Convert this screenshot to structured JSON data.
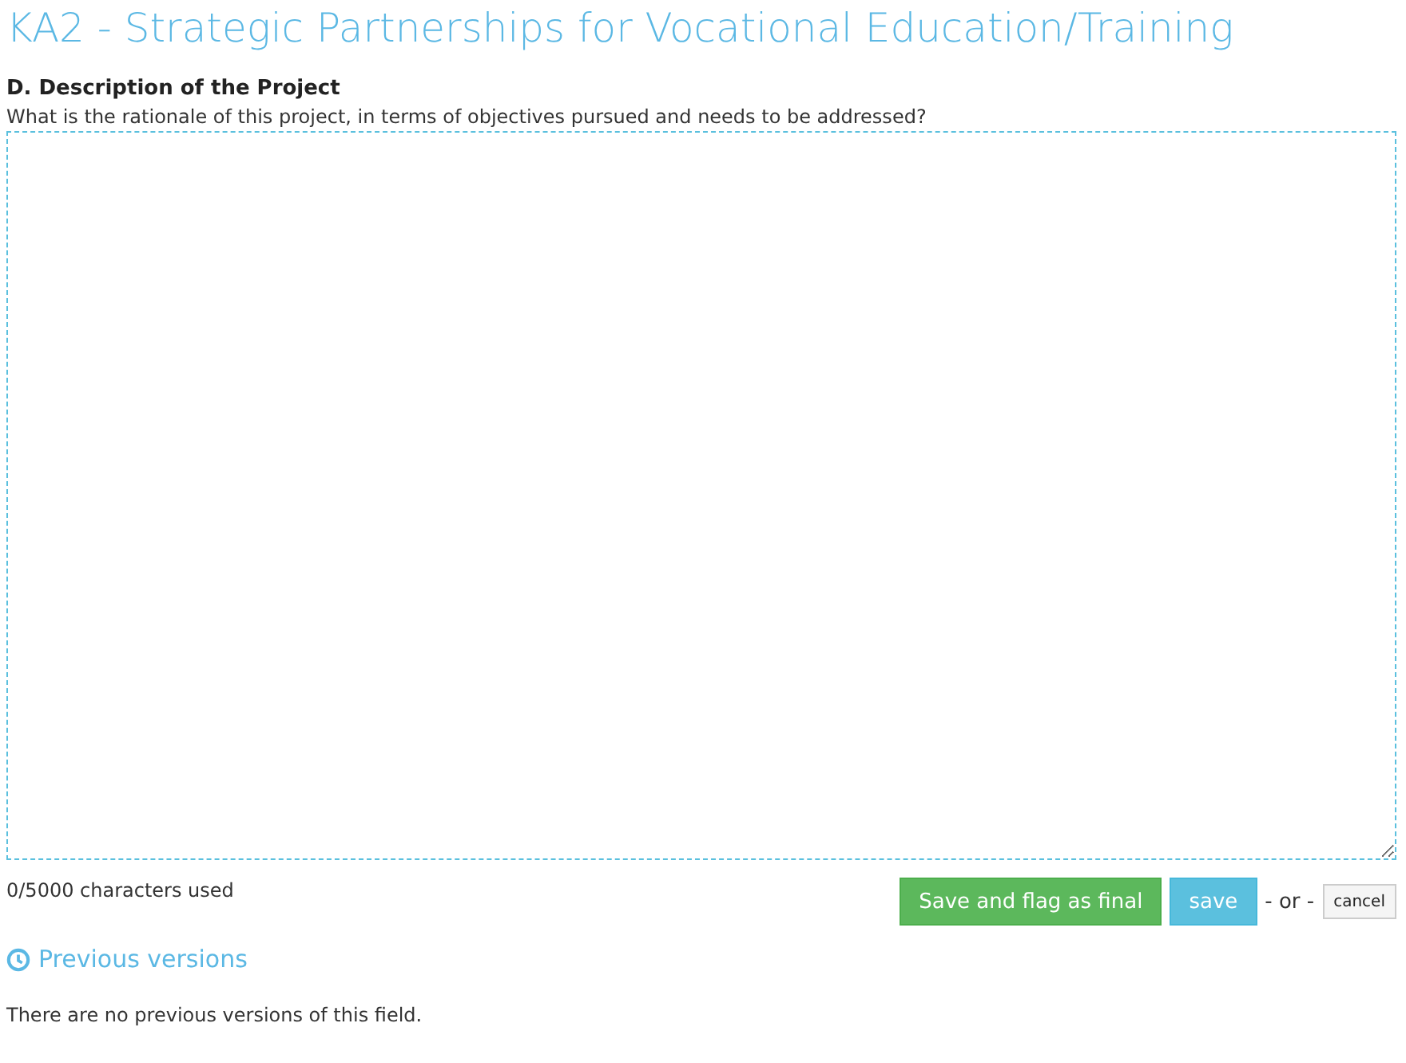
{
  "page_title": "KA2 - Strategic Partnerships for Vocational Education/Training",
  "section": {
    "heading": "D. Description of the Project",
    "question": "What is the rationale of this project, in terms of objectives pursued and needs to be addressed?"
  },
  "counter": "0/5000 characters used",
  "actions": {
    "final_button": "Save and flag as final",
    "save_button": "save",
    "separator": "- or -",
    "cancel_button": "cancel"
  },
  "history": {
    "link": "Previous versions",
    "message": "There are no previous versions of this field."
  }
}
